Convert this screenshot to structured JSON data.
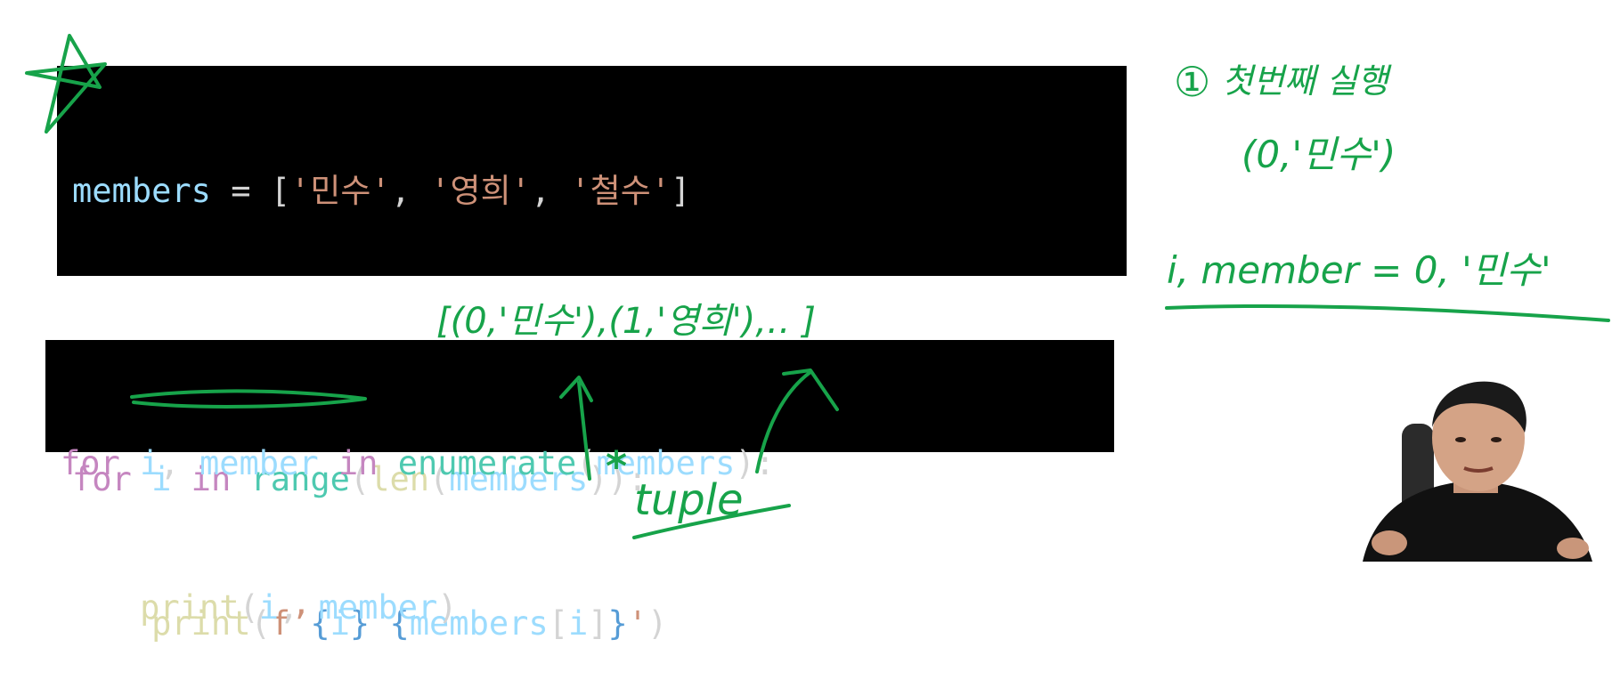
{
  "code_block_1": {
    "line1": {
      "var": "members",
      "op": " = ",
      "open": "[",
      "s1": "'민수'",
      "c1": ", ",
      "s2": "'영희'",
      "c2": ", ",
      "s3": "'철수'",
      "close": "]"
    },
    "line3": {
      "kw_for": "for",
      "sp1": " ",
      "var_i": "i",
      "sp2": " ",
      "kw_in": "in",
      "sp3": " ",
      "fn_range": "range",
      "p1": "(",
      "fn_len": "len",
      "p2": "(",
      "var_members": "members",
      "p3": "))",
      "colon": ":"
    },
    "line4": {
      "indent": "    ",
      "fn_print": "print",
      "p1": "(",
      "fstr": "f’",
      "b1": "{",
      "var_i": "i",
      "b2": "}",
      "sp": " ",
      "b3": "{",
      "var_members": "members",
      "idx_open": "[",
      "var_i2": "i",
      "idx_close": "]",
      "b4": "}",
      "q": "'",
      "p2": ")"
    }
  },
  "code_block_2": {
    "line1": {
      "kw_for": "for",
      "sp1": " ",
      "var_i": "i",
      "comma": ", ",
      "var_member": "member",
      "sp2": " ",
      "kw_in": "in",
      "sp3": " ",
      "fn_enumerate": "enumerate",
      "p1": "(",
      "var_members": "members",
      "p2": ")",
      "colon": ":"
    },
    "line2": {
      "indent": "    ",
      "fn_print": "print",
      "p1": "(",
      "var_i": "i",
      "comma": ", ",
      "var_member": "member",
      "p2": ")"
    }
  },
  "annotations": {
    "list_note": "[(0,'민수'),(1,'영희'),‥ ]",
    "tuple_note": "tuple",
    "star_note": "*",
    "step_number": "①",
    "step_title": "첫번째 실행",
    "step_tuple": "(0,'민수')",
    "step_assign": "i, member = 0, '민수'"
  },
  "colors": {
    "code_background": "#000000",
    "keyword": "#c586c0",
    "variable": "#9cdcfe",
    "function": "#dcdcaa",
    "builtin": "#4ec9b0",
    "string": "#ce9178",
    "handwriting": "#17a34a"
  }
}
